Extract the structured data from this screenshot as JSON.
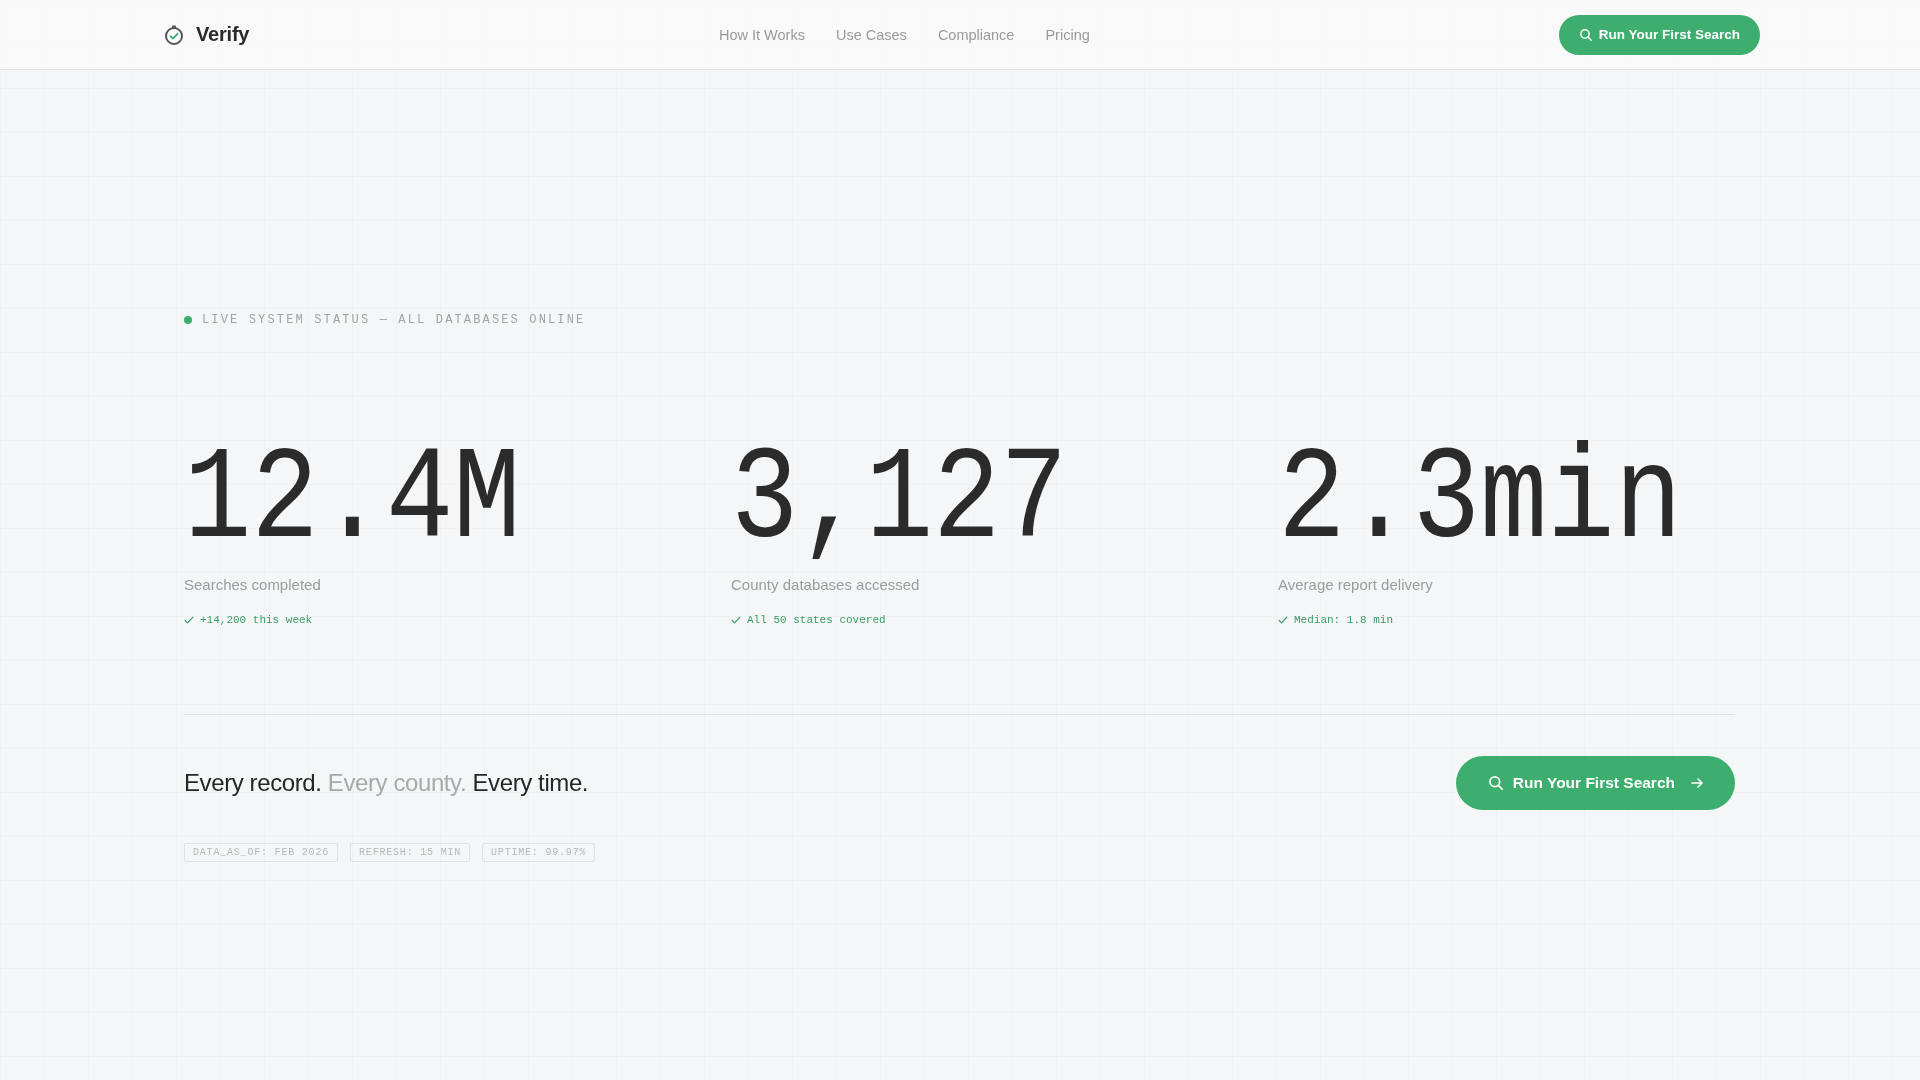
{
  "header": {
    "brand": "Verify",
    "nav": [
      {
        "label": "How It Works"
      },
      {
        "label": "Use Cases"
      },
      {
        "label": "Compliance"
      },
      {
        "label": "Pricing"
      }
    ],
    "cta": "Run Your First Search"
  },
  "status": {
    "text": "LIVE SYSTEM STATUS — ALL DATABASES ONLINE"
  },
  "stats": [
    {
      "value": "12.4M",
      "label": "Searches completed",
      "note": "+14,200 this week"
    },
    {
      "value": "3,127",
      "label": "County databases accessed",
      "note": "All 50 states covered"
    },
    {
      "value": "2.3min",
      "label": "Average report delivery",
      "note": "Median: 1.8 min"
    }
  ],
  "tagline": [
    {
      "text": "Every record.",
      "muted": false
    },
    {
      "text": "Every county.",
      "muted": true
    },
    {
      "text": "Every time.",
      "muted": false
    }
  ],
  "cta": {
    "label": "Run Your First Search"
  },
  "tags": [
    "DATA_AS_OF: FEB 2026",
    "REFRESH: 15 MIN",
    "UPTIME: 99.97%"
  ]
}
